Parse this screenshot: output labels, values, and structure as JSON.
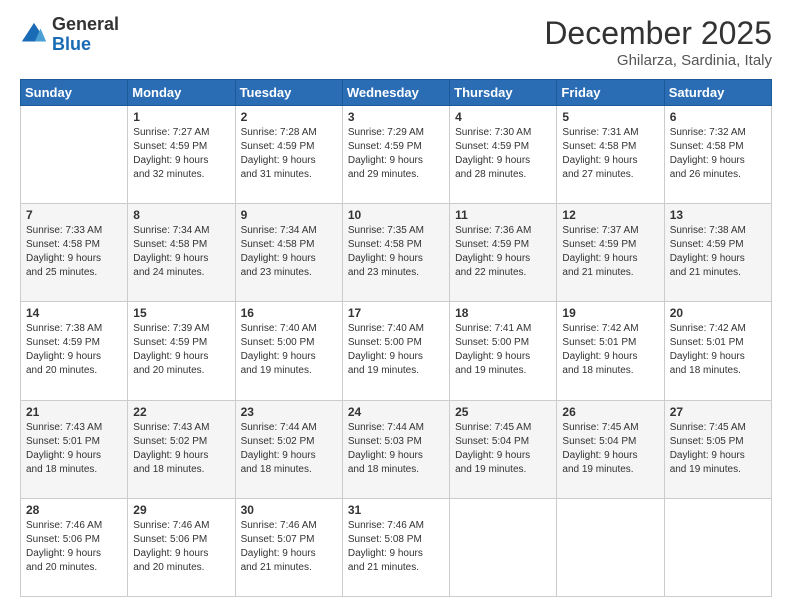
{
  "header": {
    "logo_general": "General",
    "logo_blue": "Blue",
    "month": "December 2025",
    "location": "Ghilarza, Sardinia, Italy"
  },
  "days": [
    "Sunday",
    "Monday",
    "Tuesday",
    "Wednesday",
    "Thursday",
    "Friday",
    "Saturday"
  ],
  "weeks": [
    [
      {
        "day": "",
        "content": ""
      },
      {
        "day": "1",
        "content": "Sunrise: 7:27 AM\nSunset: 4:59 PM\nDaylight: 9 hours\nand 32 minutes."
      },
      {
        "day": "2",
        "content": "Sunrise: 7:28 AM\nSunset: 4:59 PM\nDaylight: 9 hours\nand 31 minutes."
      },
      {
        "day": "3",
        "content": "Sunrise: 7:29 AM\nSunset: 4:59 PM\nDaylight: 9 hours\nand 29 minutes."
      },
      {
        "day": "4",
        "content": "Sunrise: 7:30 AM\nSunset: 4:59 PM\nDaylight: 9 hours\nand 28 minutes."
      },
      {
        "day": "5",
        "content": "Sunrise: 7:31 AM\nSunset: 4:58 PM\nDaylight: 9 hours\nand 27 minutes."
      },
      {
        "day": "6",
        "content": "Sunrise: 7:32 AM\nSunset: 4:58 PM\nDaylight: 9 hours\nand 26 minutes."
      }
    ],
    [
      {
        "day": "7",
        "content": "Sunrise: 7:33 AM\nSunset: 4:58 PM\nDaylight: 9 hours\nand 25 minutes."
      },
      {
        "day": "8",
        "content": "Sunrise: 7:34 AM\nSunset: 4:58 PM\nDaylight: 9 hours\nand 24 minutes."
      },
      {
        "day": "9",
        "content": "Sunrise: 7:34 AM\nSunset: 4:58 PM\nDaylight: 9 hours\nand 23 minutes."
      },
      {
        "day": "10",
        "content": "Sunrise: 7:35 AM\nSunset: 4:58 PM\nDaylight: 9 hours\nand 23 minutes."
      },
      {
        "day": "11",
        "content": "Sunrise: 7:36 AM\nSunset: 4:59 PM\nDaylight: 9 hours\nand 22 minutes."
      },
      {
        "day": "12",
        "content": "Sunrise: 7:37 AM\nSunset: 4:59 PM\nDaylight: 9 hours\nand 21 minutes."
      },
      {
        "day": "13",
        "content": "Sunrise: 7:38 AM\nSunset: 4:59 PM\nDaylight: 9 hours\nand 21 minutes."
      }
    ],
    [
      {
        "day": "14",
        "content": "Sunrise: 7:38 AM\nSunset: 4:59 PM\nDaylight: 9 hours\nand 20 minutes."
      },
      {
        "day": "15",
        "content": "Sunrise: 7:39 AM\nSunset: 4:59 PM\nDaylight: 9 hours\nand 20 minutes."
      },
      {
        "day": "16",
        "content": "Sunrise: 7:40 AM\nSunset: 5:00 PM\nDaylight: 9 hours\nand 19 minutes."
      },
      {
        "day": "17",
        "content": "Sunrise: 7:40 AM\nSunset: 5:00 PM\nDaylight: 9 hours\nand 19 minutes."
      },
      {
        "day": "18",
        "content": "Sunrise: 7:41 AM\nSunset: 5:00 PM\nDaylight: 9 hours\nand 19 minutes."
      },
      {
        "day": "19",
        "content": "Sunrise: 7:42 AM\nSunset: 5:01 PM\nDaylight: 9 hours\nand 18 minutes."
      },
      {
        "day": "20",
        "content": "Sunrise: 7:42 AM\nSunset: 5:01 PM\nDaylight: 9 hours\nand 18 minutes."
      }
    ],
    [
      {
        "day": "21",
        "content": "Sunrise: 7:43 AM\nSunset: 5:01 PM\nDaylight: 9 hours\nand 18 minutes."
      },
      {
        "day": "22",
        "content": "Sunrise: 7:43 AM\nSunset: 5:02 PM\nDaylight: 9 hours\nand 18 minutes."
      },
      {
        "day": "23",
        "content": "Sunrise: 7:44 AM\nSunset: 5:02 PM\nDaylight: 9 hours\nand 18 minutes."
      },
      {
        "day": "24",
        "content": "Sunrise: 7:44 AM\nSunset: 5:03 PM\nDaylight: 9 hours\nand 18 minutes."
      },
      {
        "day": "25",
        "content": "Sunrise: 7:45 AM\nSunset: 5:04 PM\nDaylight: 9 hours\nand 19 minutes."
      },
      {
        "day": "26",
        "content": "Sunrise: 7:45 AM\nSunset: 5:04 PM\nDaylight: 9 hours\nand 19 minutes."
      },
      {
        "day": "27",
        "content": "Sunrise: 7:45 AM\nSunset: 5:05 PM\nDaylight: 9 hours\nand 19 minutes."
      }
    ],
    [
      {
        "day": "28",
        "content": "Sunrise: 7:46 AM\nSunset: 5:06 PM\nDaylight: 9 hours\nand 20 minutes."
      },
      {
        "day": "29",
        "content": "Sunrise: 7:46 AM\nSunset: 5:06 PM\nDaylight: 9 hours\nand 20 minutes."
      },
      {
        "day": "30",
        "content": "Sunrise: 7:46 AM\nSunset: 5:07 PM\nDaylight: 9 hours\nand 21 minutes."
      },
      {
        "day": "31",
        "content": "Sunrise: 7:46 AM\nSunset: 5:08 PM\nDaylight: 9 hours\nand 21 minutes."
      },
      {
        "day": "",
        "content": ""
      },
      {
        "day": "",
        "content": ""
      },
      {
        "day": "",
        "content": ""
      }
    ]
  ]
}
